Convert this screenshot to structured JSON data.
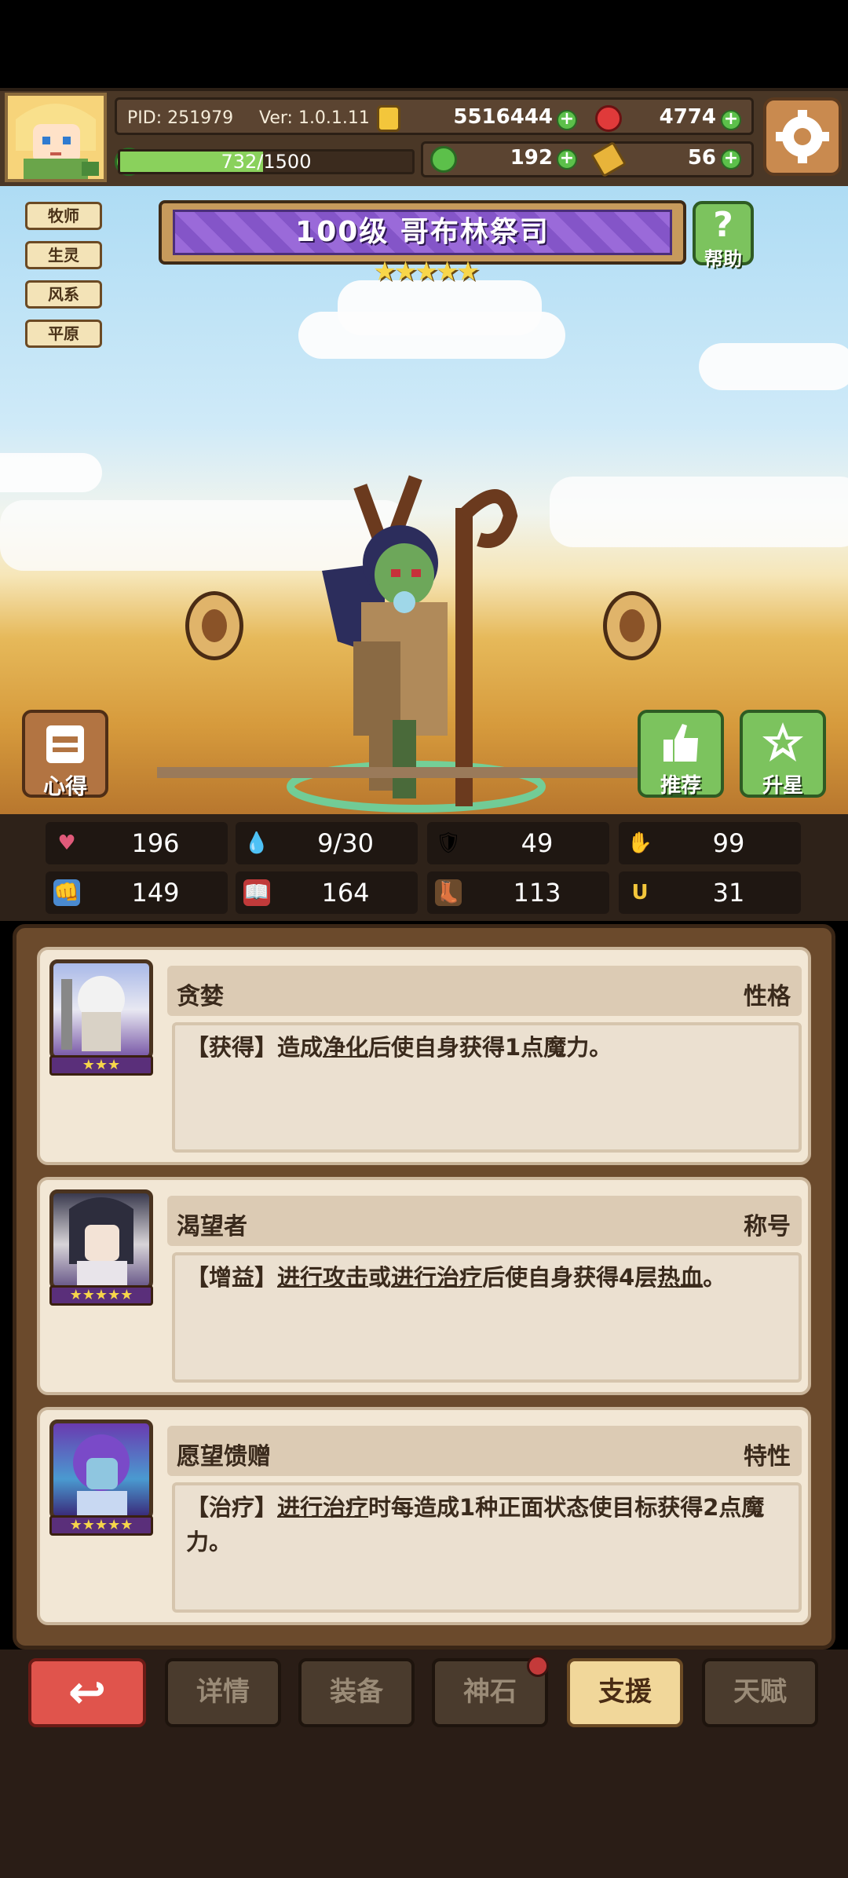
{
  "header": {
    "pid": "PID: 251979",
    "version": "Ver: 1.0.1.11",
    "gold": "5516444",
    "gems": "4774",
    "xp": "732/1500",
    "xp_fraction": 0.488,
    "clover": "192",
    "keys": "56"
  },
  "tags": [
    "牧师",
    "生灵",
    "风系",
    "平原"
  ],
  "hero": {
    "title": "100级 哥布林祭司",
    "stars": "★★★★★",
    "help_label": "帮助",
    "left_button": "心得",
    "recommend_label": "推荐",
    "star_up_label": "升星"
  },
  "stats": [
    {
      "icon": "♥",
      "value": "196"
    },
    {
      "icon": "💧",
      "value": "9/30"
    },
    {
      "icon": "🛡",
      "value": "49"
    },
    {
      "icon": "✋",
      "value": "99"
    },
    {
      "icon": "👊",
      "value": "149"
    },
    {
      "icon": "📖",
      "value": "164"
    },
    {
      "icon": "👢",
      "value": "113"
    },
    {
      "icon": "U",
      "value": "31"
    }
  ],
  "cards": [
    {
      "name": "贪婪",
      "type": "性格",
      "stars": "★★★",
      "desc_html": "【获得】造成<u>净化</u>后使自身获得1点魔力。"
    },
    {
      "name": "渴望者",
      "type": "称号",
      "stars": "★★★★★",
      "desc_html": "【增益】<u>进行攻击</u>或<u>进行治疗</u>后使自身获得4层<u>热血</u>。"
    },
    {
      "name": "愿望馈赠",
      "type": "特性",
      "stars": "★★★★★",
      "desc_html": "【治疗】<u>进行治疗</u>时每造成1种正面状态使目标获得2点魔力。"
    }
  ],
  "nav": {
    "back_icon": "↩",
    "details": "详情",
    "equip": "装备",
    "stone": "神石",
    "support": "支援",
    "talent": "天赋"
  },
  "colors": {
    "accent_green": "#7cc35e",
    "title_purple": "#9a6ad9",
    "back_red": "#e0544c",
    "active_tab": "#f1d79a"
  }
}
